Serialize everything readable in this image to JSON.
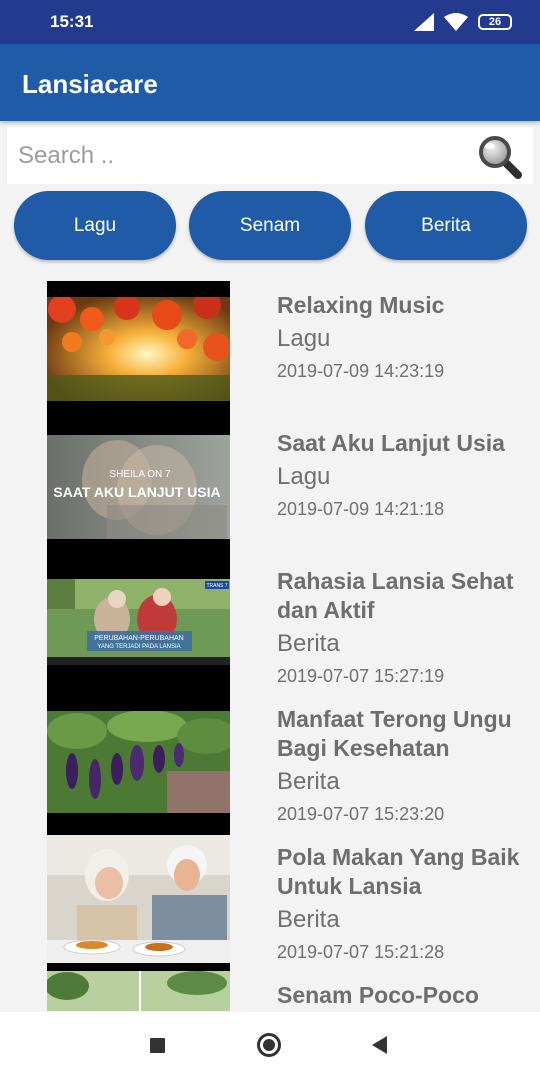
{
  "status_bar": {
    "time": "15:31",
    "battery": "26"
  },
  "app_bar": {
    "title": "Lansiacare"
  },
  "search": {
    "placeholder": "Search ..",
    "value": ""
  },
  "categories": [
    {
      "label": "Lagu"
    },
    {
      "label": "Senam"
    },
    {
      "label": "Berita"
    }
  ],
  "thumbnail_captions": {
    "item_2_artist": "SHEILA ON 7",
    "item_2_song": "SAAT AKU LANJUT USIA",
    "item_3_channel": "TRANS 7",
    "item_3_caption_line1": "PERUBAHAN-PERUBAHAN",
    "item_3_caption_line2": "YANG TERJADI PADA LANSIA"
  },
  "items": [
    {
      "title": "Relaxing Music",
      "category": "Lagu",
      "date": "2019-07-09 14:23:19"
    },
    {
      "title": "Saat Aku Lanjut Usia",
      "category": "Lagu",
      "date": "2019-07-09 14:21:18"
    },
    {
      "title": "Rahasia Lansia Sehat dan Aktif",
      "category": "Berita",
      "date": "2019-07-07 15:27:19"
    },
    {
      "title": "Manfaat Terong Ungu Bagi Kesehatan",
      "category": "Berita",
      "date": "2019-07-07 15:23:20"
    },
    {
      "title": "Pola Makan Yang Baik Untuk Lansia",
      "category": "Berita",
      "date": "2019-07-07 15:21:28"
    },
    {
      "title": "Senam Poco-Poco",
      "category": "",
      "date": ""
    }
  ],
  "colors": {
    "status_bar": "#243a8f",
    "app_bar": "#1f5ba7",
    "button": "#1f5ba7",
    "background": "#f3f3f3"
  },
  "icons": {
    "search": "magnifier-icon",
    "signal": "signal-icon",
    "wifi": "wifi-icon",
    "battery": "battery-icon"
  }
}
